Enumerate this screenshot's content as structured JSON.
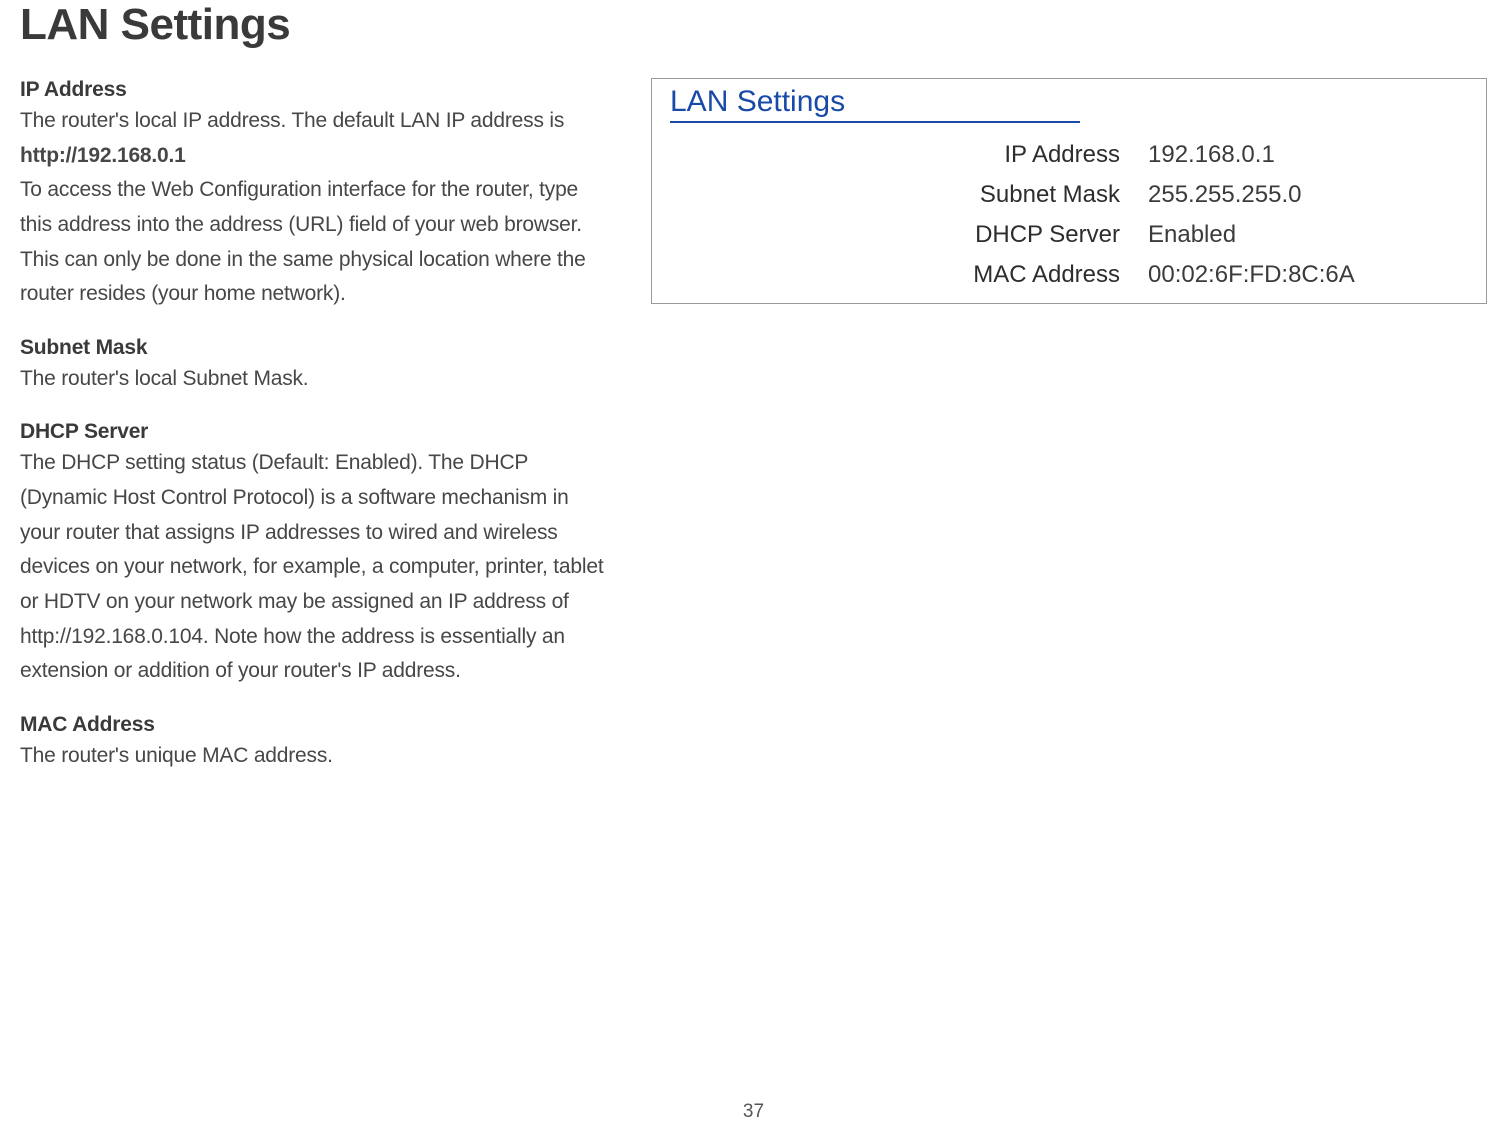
{
  "title": "LAN Settings",
  "left": {
    "ip_address": {
      "heading": "IP Address",
      "body_1": "The router's local IP address. The default LAN IP address is",
      "bold_line": "http://192.168.0.1",
      "body_2": "To access the Web Configuration interface for the router, type this address into the address (URL) field of your web browser. This can only be done in the same physical location where the router resides (your home network)."
    },
    "subnet_mask": {
      "heading": "Subnet Mask",
      "body": "The router's local Subnet Mask."
    },
    "dhcp_server": {
      "heading": "DHCP Server",
      "body": "The DHCP setting status (Default: Enabled). The DHCP (Dynamic Host Control Protocol) is a software mechanism in your router that assigns IP addresses to wired and wireless devices on your network, for example, a computer, printer, tablet or HDTV on your network may be assigned an IP address of http://192.168.0.104. Note how the address is essentially an extension or addition of your router's IP address."
    },
    "mac_address": {
      "heading": "MAC Address",
      "body": "The router's unique MAC address."
    }
  },
  "panel": {
    "title": "LAN Settings",
    "rows": {
      "ip_address": {
        "label": "IP Address",
        "value": "192.168.0.1"
      },
      "subnet_mask": {
        "label": "Subnet Mask",
        "value": "255.255.255.0"
      },
      "dhcp_server": {
        "label": "DHCP Server",
        "value": "Enabled"
      },
      "mac_address": {
        "label": "MAC Address",
        "value": "00:02:6F:FD:8C:6A"
      }
    }
  },
  "page_number": "37"
}
